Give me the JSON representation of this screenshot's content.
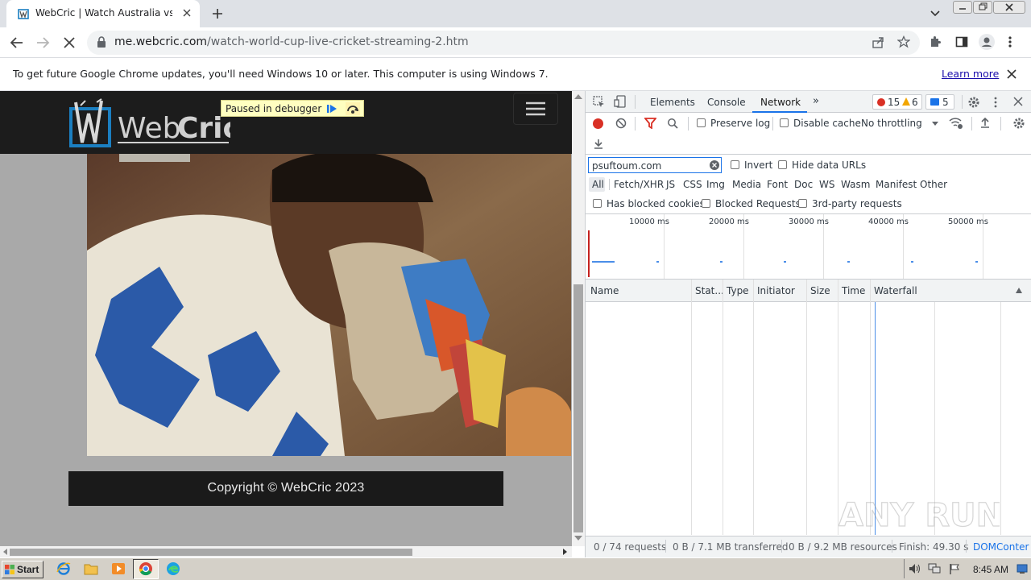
{
  "browser": {
    "tab_title": "WebCric | Watch Australia vs South",
    "url_host": "me.webcric.com",
    "url_path": "/watch-world-cup-live-cricket-streaming-2.htm",
    "infobar_text": "To get future Google Chrome updates, you'll need Windows 10 or later. This computer is using Windows 7.",
    "infobar_link": "Learn more"
  },
  "page": {
    "logo_text_a": "Web",
    "logo_text_b": "Cric",
    "debugger_label": "Paused in debugger",
    "copyright": "Copyright © WebCric 2023",
    "colors": {
      "header_bg": "#1c1c1c",
      "page_bg": "#a9a9a9",
      "logo_blue": "#1b7fc1"
    }
  },
  "devtools": {
    "tabs": [
      "Elements",
      "Console",
      "Network"
    ],
    "active_tab": "Network",
    "errors_count": "15",
    "warnings_count": "6",
    "messages_count": "5",
    "preserve_log": "Preserve log",
    "disable_cache": "Disable cache",
    "throttling": "No throttling",
    "filter_value": "psuftoum.com",
    "invert": "Invert",
    "hide_data_urls": "Hide data URLs",
    "filter_types": [
      "All",
      "Fetch/XHR",
      "JS",
      "CSS",
      "Img",
      "Media",
      "Font",
      "Doc",
      "WS",
      "Wasm",
      "Manifest",
      "Other"
    ],
    "has_blocked_cookies": "Has blocked cookies",
    "blocked_requests": "Blocked Requests",
    "third_party": "3rd-party requests",
    "timeline_ticks": [
      "10000 ms",
      "20000 ms",
      "30000 ms",
      "40000 ms",
      "50000 ms"
    ],
    "columns": [
      "Name",
      "Stat...",
      "Type",
      "Initiator",
      "Size",
      "Time",
      "Waterfall"
    ],
    "status": {
      "requests": "0 / 74 requests",
      "transferred": "0 B / 7.1 MB transferred",
      "resources": "0 B / 9.2 MB resources",
      "finish": "Finish: 49.30 s",
      "domcontent": "DOMConter"
    },
    "watermark": "ANY RUN"
  },
  "taskbar": {
    "start_label": "Start",
    "clock": "8:45 AM"
  }
}
